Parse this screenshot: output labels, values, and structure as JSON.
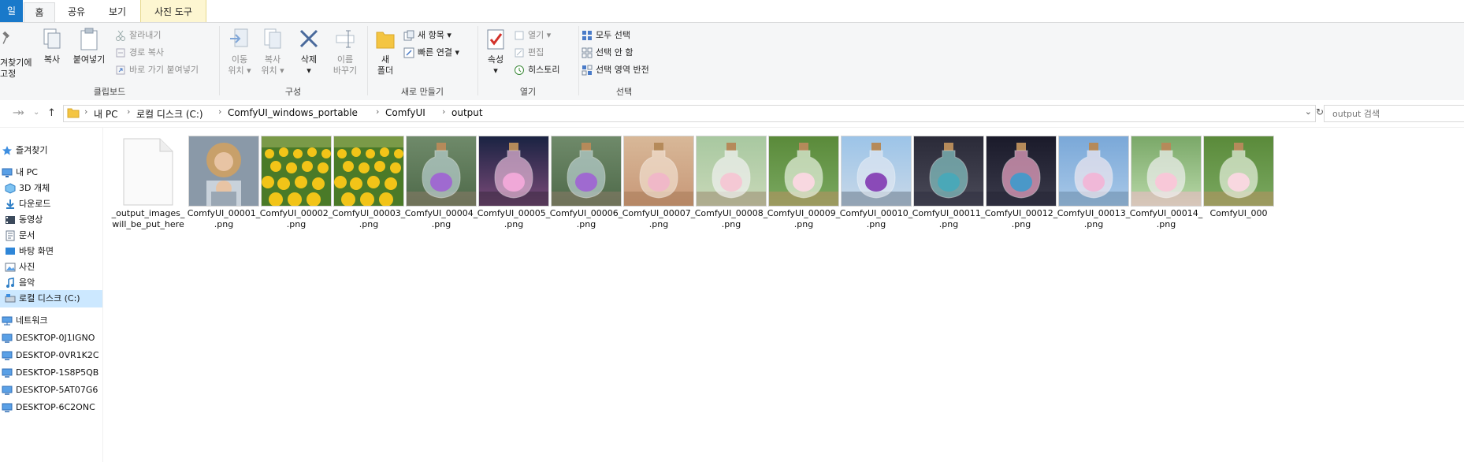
{
  "tabs": {
    "file": "일",
    "home": "홈",
    "share": "공유",
    "view": "보기",
    "picture_tools": "사진 도구"
  },
  "ribbon": {
    "clipboard": {
      "pin_line1": "겨찾기에",
      "pin_line2": "고정",
      "copy": "복사",
      "paste": "붙여넣기",
      "cut": "잘라내기",
      "copy_path": "경로 복사",
      "paste_shortcut": "바로 가기 붙여넣기",
      "label": "클립보드"
    },
    "organize": {
      "move_line1": "이동",
      "move_line2": "위치",
      "copyto_line1": "복사",
      "copyto_line2": "위치",
      "delete": "삭제",
      "rename_line1": "이름",
      "rename_line2": "바꾸기",
      "label": "구성"
    },
    "new": {
      "new_folder_line1": "새",
      "new_folder_line2": "폴더",
      "new_item": "새 항목",
      "easy_access": "빠른 연결",
      "label": "새로 만들기"
    },
    "open": {
      "properties": "속성",
      "open": "열기",
      "edit": "편집",
      "history": "히스토리",
      "label": "열기"
    },
    "select": {
      "select_all": "모두 선택",
      "select_none": "선택 안 함",
      "invert": "선택 영역 반전",
      "label": "선택"
    }
  },
  "address": {
    "breadcrumbs": [
      "내 PC",
      "로컬 디스크 (C:)",
      "ComfyUI_windows_portable",
      "ComfyUI",
      "output"
    ],
    "search_placeholder": "output 검색"
  },
  "nav": {
    "items": [
      {
        "label": "즐겨찾기",
        "icon": "star-icon"
      },
      {
        "label": "내 PC",
        "icon": "computer-icon"
      },
      {
        "label": "3D 개체",
        "icon": "cube-icon"
      },
      {
        "label": "다운로드",
        "icon": "download-icon"
      },
      {
        "label": "동영상",
        "icon": "video-icon"
      },
      {
        "label": "문서",
        "icon": "document-icon"
      },
      {
        "label": "바탕 화면",
        "icon": "desktop-icon"
      },
      {
        "label": "사진",
        "icon": "picture-icon"
      },
      {
        "label": "음악",
        "icon": "music-icon"
      },
      {
        "label": "로컬 디스크 (C:)",
        "icon": "drive-icon"
      },
      {
        "label": "네트워크",
        "icon": "network-icon"
      },
      {
        "label": "DESKTOP-0J1IGNO",
        "icon": "monitor-icon"
      },
      {
        "label": "DESKTOP-0VR1K2C",
        "icon": "monitor-icon"
      },
      {
        "label": "DESKTOP-1S8P5QB",
        "icon": "monitor-icon"
      },
      {
        "label": "DESKTOP-5AT07G6",
        "icon": "monitor-icon"
      },
      {
        "label": "DESKTOP-6C2ONC",
        "icon": "monitor-icon"
      }
    ]
  },
  "files": [
    {
      "line1": "_output_images_",
      "line2": "will_be_put_here",
      "kind": "blank"
    },
    {
      "line1": "ComfyUI_00001_",
      "line2": ".png",
      "kind": "portrait"
    },
    {
      "line1": "ComfyUI_00002_",
      "line2": ".png",
      "kind": "sunflower"
    },
    {
      "line1": "ComfyUI_00003_",
      "line2": ".png",
      "kind": "sunflower"
    },
    {
      "line1": "ComfyUI_00004_",
      "line2": ".png",
      "kind": "bottle-purple"
    },
    {
      "line1": "ComfyUI_00005_",
      "line2": ".png",
      "kind": "bottle-night"
    },
    {
      "line1": "ComfyUI_00006_",
      "line2": ".png",
      "kind": "bottle-purple"
    },
    {
      "line1": "ComfyUI_00007_",
      "line2": ".png",
      "kind": "bottle-warm"
    },
    {
      "line1": "ComfyUI_00008_",
      "line2": ".png",
      "kind": "bottle-bunny"
    },
    {
      "line1": "ComfyUI_00009_",
      "line2": ".png",
      "kind": "bottle-green"
    },
    {
      "line1": "ComfyUI_00010_",
      "line2": ".png",
      "kind": "bottle-sky"
    },
    {
      "line1": "ComfyUI_00011_",
      "line2": ".png",
      "kind": "bottle-dark"
    },
    {
      "line1": "ComfyUI_00012_",
      "line2": ".png",
      "kind": "bottle-dark2"
    },
    {
      "line1": "ComfyUI_00013_",
      "line2": ".png",
      "kind": "bottle-sky2"
    },
    {
      "line1": "ComfyUI_00014_",
      "line2": ".png",
      "kind": "bottle-pink"
    },
    {
      "line1": "ComfyUI_000",
      "line2": "",
      "kind": "bottle-green"
    }
  ],
  "colors": {
    "accent": "#1979ca",
    "selection": "#cce8ff",
    "ribbon_bg": "#f5f6f7",
    "tools_tab": "#fdf6d1"
  }
}
